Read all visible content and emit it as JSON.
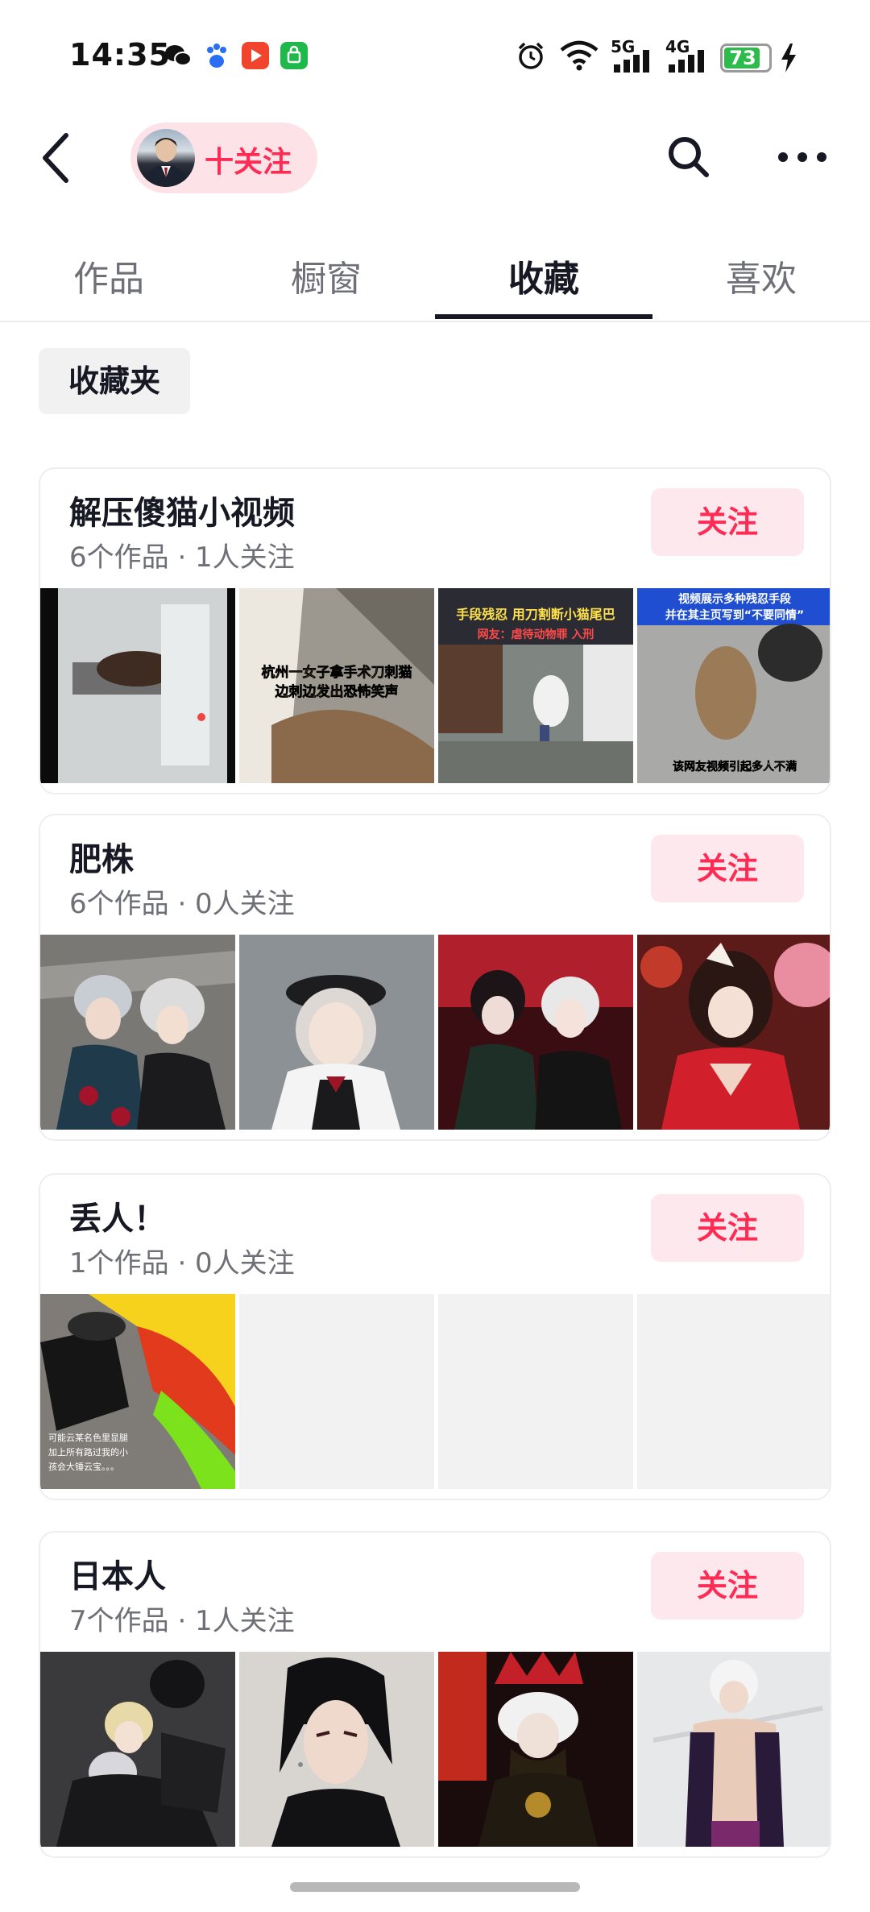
{
  "status_bar": {
    "time": "14:35",
    "network_5g": "5G",
    "network_4g": "4G",
    "battery": "73",
    "icons": [
      "wechat-icon",
      "baidu-icon",
      "video-app-icon",
      "shop-app-icon",
      "alarm-icon",
      "wifi-icon",
      "signal-icon",
      "battery-icon",
      "charging-icon"
    ]
  },
  "header": {
    "follow_label": "十关注",
    "icons": [
      "back-icon",
      "search-icon",
      "more-icon"
    ]
  },
  "tabs": [
    {
      "label": "作品",
      "active": false
    },
    {
      "label": "橱窗",
      "active": false
    },
    {
      "label": "收藏",
      "active": true
    },
    {
      "label": "喜欢",
      "active": false
    }
  ],
  "filter_chip": "收藏夹",
  "folders": [
    {
      "title": "解压傻猫小视频",
      "meta": "6个作品 · 1人关注",
      "follow": "关注",
      "thumb_texts": [
        "杭州一女子拿手术刀刺猫",
        "边刺边发出恐怖笑声",
        "手段残忍 用刀割断小猫尾巴",
        "网友：虐待动物罪 入刑",
        "视频展示多种残忍手段",
        "并在其主页写到“不要同情”",
        "该网友视频引起多人不满"
      ]
    },
    {
      "title": "肥株",
      "meta": "6个作品 · 0人关注",
      "follow": "关注"
    },
    {
      "title": "丢人！",
      "meta": "1个作品 · 0人关注",
      "follow": "关注",
      "thumb_texts": [
        "可能云某名色里显腿",
        "加上所有路过我的小",
        "孩会大锤云宝。。。"
      ]
    },
    {
      "title": "日本人",
      "meta": "7个作品 · 1人关注",
      "follow": "关注"
    }
  ],
  "colors": {
    "accent": "#fe2c55",
    "pill_bg": "#fde3e8",
    "button_bg": "#fde9ed",
    "text": "#161823",
    "muted": "#6f7077"
  }
}
